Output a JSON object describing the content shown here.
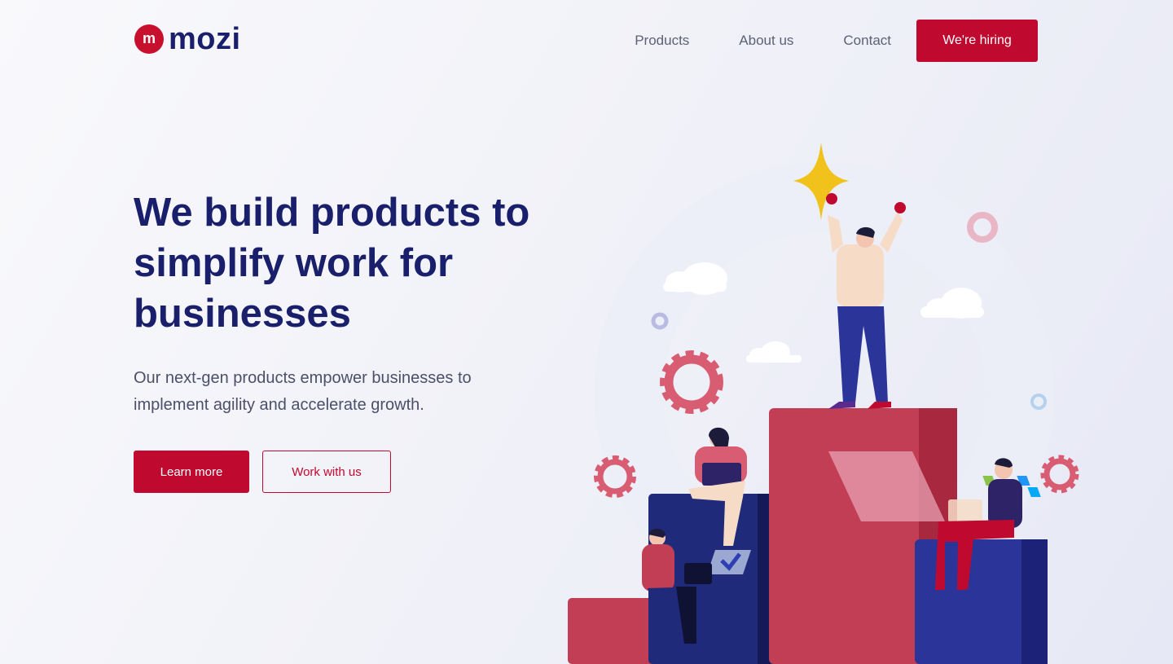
{
  "brand": {
    "logo_letter": "m",
    "name": "mozi"
  },
  "nav": {
    "items": [
      {
        "label": "Products"
      },
      {
        "label": "About us"
      },
      {
        "label": "Contact"
      }
    ],
    "cta_label": "We're hiring"
  },
  "hero": {
    "title": "We build products to simplify work for businesses",
    "subtitle": "Our next-gen products empower businesses to implement agility and accelerate growth.",
    "primary_button": "Learn more",
    "secondary_button": "Work with us"
  },
  "colors": {
    "brand_red": "#c0092e",
    "navy": "#1a1f6b",
    "text_gray": "#4b5068",
    "podium_red": "#c23e55",
    "podium_blue": "#2b3499",
    "star_yellow": "#f1c21b"
  },
  "illustration": {
    "icons": [
      "star-icon",
      "gear-icon",
      "cloud-icon",
      "ring-icon",
      "laptop-icon",
      "kanban-board-icon",
      "checkmark-icon"
    ]
  }
}
